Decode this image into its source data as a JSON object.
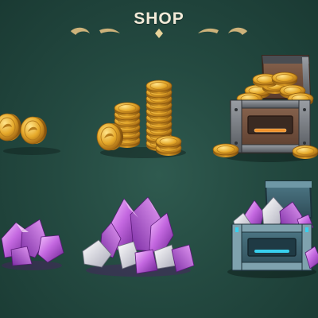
{
  "header": {
    "title": "SHOP"
  },
  "shop_items": [
    {
      "name": "small-coin-pile",
      "currency": "coins"
    },
    {
      "name": "medium-coin-stack",
      "currency": "coins"
    },
    {
      "name": "coin-chest",
      "currency": "coins"
    },
    {
      "name": "small-crystal-pile",
      "currency": "crystals"
    },
    {
      "name": "medium-crystal-cluster",
      "currency": "crystals"
    },
    {
      "name": "crystal-chest",
      "currency": "crystals"
    }
  ],
  "colors": {
    "background": "#244a41",
    "title": "#f2ead8",
    "gold": "#e0a526",
    "crystal": "#b85ad8",
    "chest_wood": "#6e4e3c",
    "chest_metal": "#3d5b66",
    "glow_orange": "#f0902a",
    "glow_cyan": "#38d0ee"
  }
}
